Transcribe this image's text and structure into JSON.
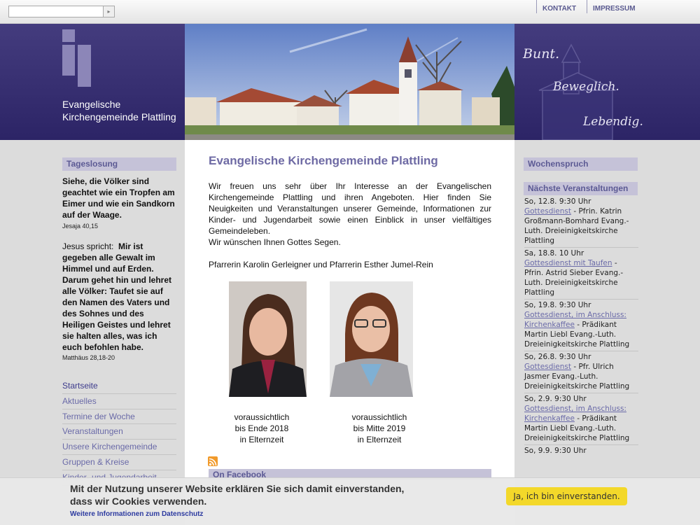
{
  "topbar": {
    "search": {
      "value": "",
      "placeholder": ""
    },
    "search_button_glyph": "▸",
    "links": [
      "KONTAKT",
      "IMPRESSUM"
    ]
  },
  "header": {
    "site_name_line1": "Evangelische",
    "site_name_line2": "Kirchengemeinde Plattling",
    "slogans": [
      "Bunt.",
      "Beweglich.",
      "Lebendig."
    ]
  },
  "left": {
    "tageslosung_title": "Tageslosung",
    "verse1": "Siehe, die Völker sind geachtet wie ein Tropfen am Eimer und wie ein Sandkorn auf der Waage.",
    "ref1": "Jesaja 40,15",
    "verse2_intro": "Jesus spricht:",
    "verse2": "Mir ist gegeben alle Gewalt im Himmel und auf Erden. Darum gehet hin und lehret alle Völker: Taufet sie auf den Namen des Vaters und des Sohnes und des Heiligen Geistes und lehret sie halten alles, was ich euch befohlen habe.",
    "ref2": "Matthäus 28,18-20",
    "nav": [
      "Startseite",
      "Aktuelles",
      "Termine der Woche",
      "Veranstaltungen",
      "Unsere Kirchengemeinde",
      "Gruppen & Kreise",
      "Kinder- und Jugendarbeit"
    ]
  },
  "main": {
    "title": "Evangelische Kirchengemeinde Plattling",
    "intro": "Wir freuen uns sehr über Ihr Interesse an der Evangelischen Kirchengemeinde Plattling und ihren Angeboten. Hier finden Sie Neuigkeiten und Veranstaltungen unserer Gemeinde, Informationen zur Kinder- und Jugendarbeit sowie einen Einblick in unser vielfältiges Gemeindeleben.",
    "blessing": "Wir wünschen Ihnen Gottes Segen.",
    "pastors": "Pfarrerin Karolin Gerleigner und Pfarrerin Esther Jumel-Rein",
    "captions": [
      [
        "voraussichtlich",
        "bis Ende 2018",
        "in Elternzeit"
      ],
      [
        "voraussichtlich",
        "bis Mitte 2019",
        "in Elternzeit"
      ]
    ],
    "facebook_title": "On Facebook"
  },
  "right": {
    "wochenspruch_title": "Wochenspruch",
    "events_title": "Nächste Veranstaltungen",
    "events": [
      {
        "date": "So, 12.8. 9:30 Uhr",
        "link": "Gottesdienst",
        "rest": " - Pfrin. Katrin Großmann-Bomhard Evang.-Luth. Dreieinigkeitskirche Plattling"
      },
      {
        "date": "Sa, 18.8. 10 Uhr",
        "link": "Gottesdienst mit Taufen",
        "rest": " - Pfrin. Astrid Sieber Evang.-Luth. Dreieinigkeitskirche Plattling"
      },
      {
        "date": "So, 19.8. 9:30 Uhr",
        "link": "Gottesdienst, im Anschluss: Kirchenkaffee",
        "rest": " - Prädikant Martin Liebl Evang.-Luth. Dreieinigkeitskirche Plattling"
      },
      {
        "date": "So, 26.8. 9:30 Uhr",
        "link": "Gottesdienst",
        "rest": " - Pfr. Ulrich Jasmer Evang.-Luth. Dreieinigkeitskirche Plattling"
      },
      {
        "date": "So, 2.9. 9:30 Uhr",
        "link": "Gottesdienst, im Anschluss: Kirchenkaffee",
        "rest": " - Prädikant Martin Liebl Evang.-Luth. Dreieinigkeitskirche Plattling"
      },
      {
        "date": "So, 9.9. 9:30 Uhr",
        "link": "",
        "rest": ""
      }
    ]
  },
  "cookie": {
    "line1": "Mit der Nutzung unserer Website erklären Sie sich damit einverstanden,",
    "line2": "dass wir Cookies verwenden.",
    "link": "Weitere Informationen zum Datenschutz",
    "accept": "Ja, ich bin einverstanden."
  },
  "colors": {
    "header_purple": "#36306f",
    "accent_lavender": "#c5c2d8",
    "link": "#6a6aa8",
    "cookie_button": "#f3d82a"
  }
}
